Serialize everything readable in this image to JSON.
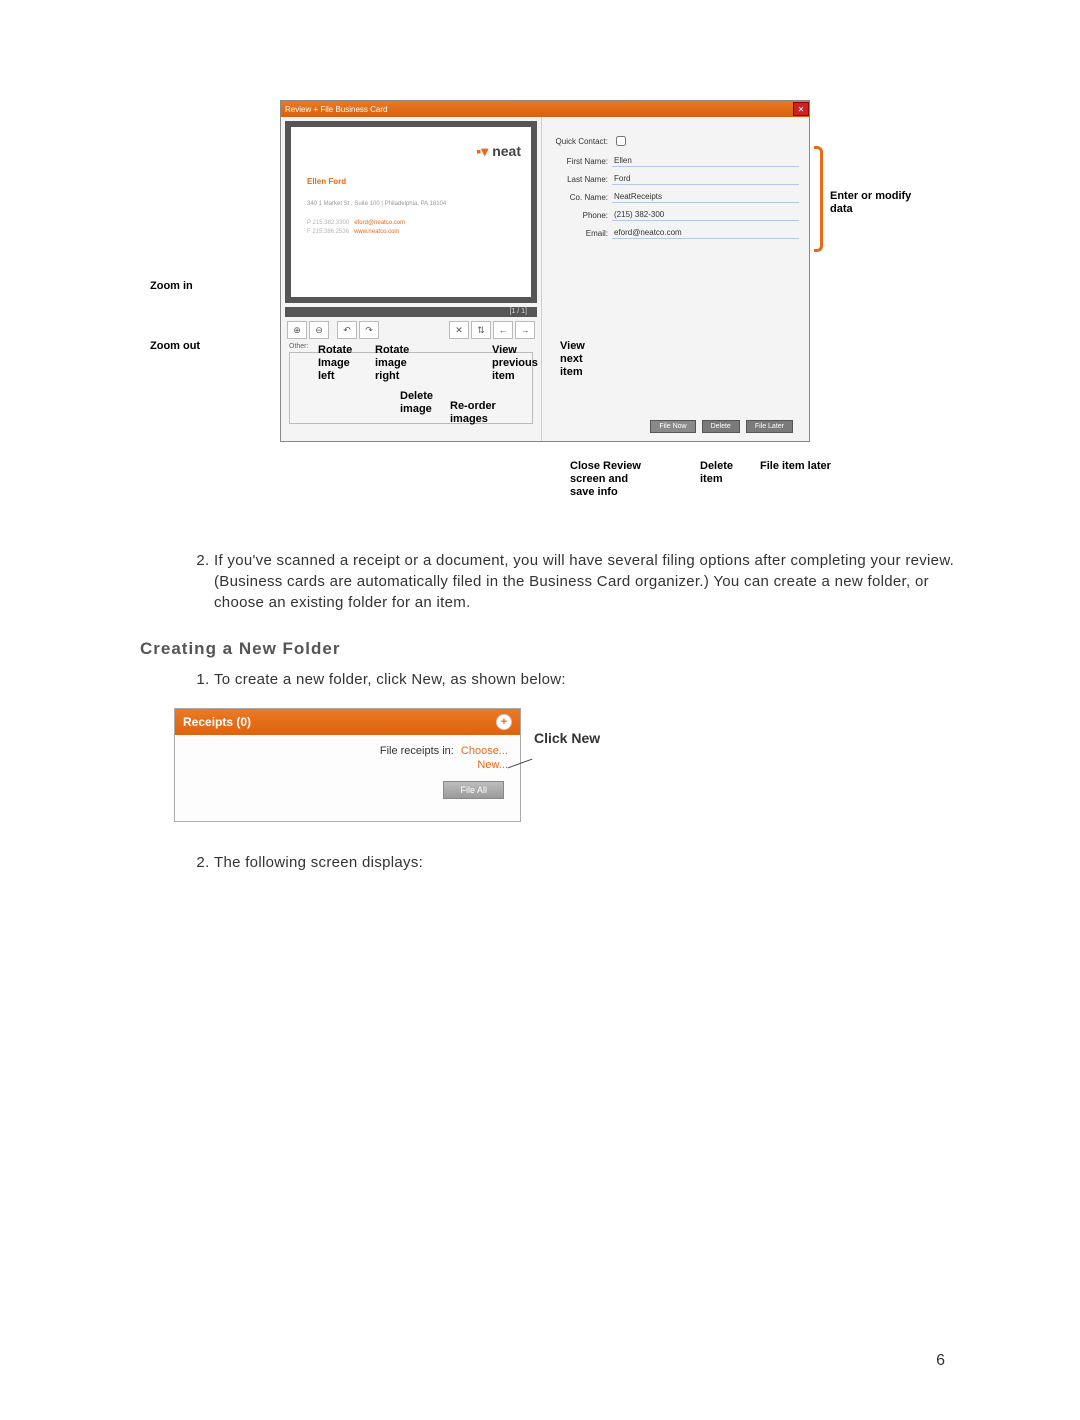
{
  "fig1": {
    "titlebar": "Review + File Business Card",
    "card": {
      "logo_text": "neat",
      "name": "Ellen Ford",
      "address": "340 1 Market St , Suite 100 | Philadelphia, PA 18104",
      "phone1": "P 215.382.3300",
      "email": "eford@neatco.com",
      "phone2": "F 215.386.2536",
      "web": "www.neatco.com",
      "count": "[1 / 1]"
    },
    "otherLabel": "Other:",
    "form": {
      "quick_contact_label": "Quick Contact:",
      "first_name_label": "First Name:",
      "last_name_label": "Last Name:",
      "co_name_label": "Co. Name:",
      "phone_label": "Phone:",
      "email_label": "Email:",
      "first_name": "Ellen",
      "last_name": "Ford",
      "co_name": "NeatReceipts",
      "phone": "(215) 382-300",
      "email": "eford@neatco.com"
    },
    "buttons": {
      "file_now": "File Now",
      "delete": "Delete",
      "file_later": "File Later"
    },
    "callouts": {
      "zoom_in": "Zoom in",
      "zoom_out": "Zoom out",
      "rotate_left": "Rotate\nImage\nleft",
      "rotate_right": "Rotate\nimage\nright",
      "delete_image": "Delete\nimage",
      "reorder": "Re-order\nimages",
      "view_prev": "View\nprevious\nitem",
      "view_next": "View\nnext\nitem",
      "enter_modify": "Enter or modify\ndata",
      "close_review": "Close Review\nscreen and\nsave info",
      "delete_item": "Delete\nitem",
      "file_later_cap": "File item later"
    }
  },
  "text": {
    "para1": "If you've scanned a receipt or a document, you will have several filing options after completing your review. (Business cards are automatically filed in the Business Card organizer.) You can create a new folder, or choose an existing folder for an item.",
    "section_heading": "Creating a New Folder",
    "step1": "To create a new folder, click New, as shown below:",
    "step2": "The following screen displays:"
  },
  "fig2": {
    "header": "Receipts (0)",
    "file_label": "File receipts in:",
    "choose": "Choose...",
    "new": "New...",
    "file_all": "File All",
    "callout": "Click New"
  },
  "page_number": "6"
}
